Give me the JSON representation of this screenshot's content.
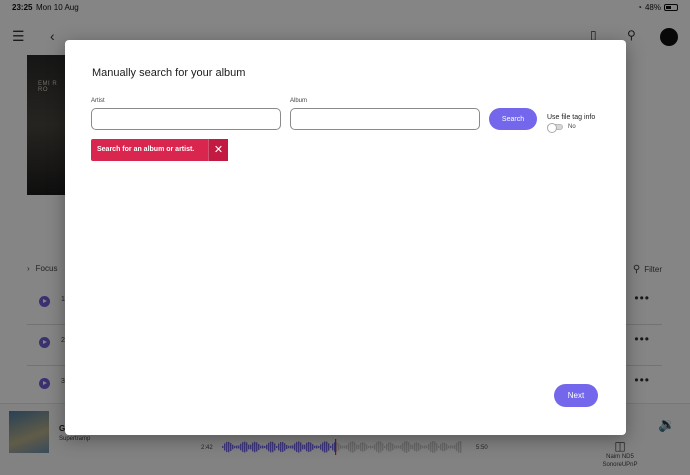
{
  "status_bar": {
    "time": "23:25",
    "date": "Mon 10 Aug",
    "battery": "48%"
  },
  "background": {
    "focus_label": "Focus",
    "filter_label": "Filter",
    "artwork_text": "EMI R RO",
    "tracks": [
      {
        "number": "1"
      },
      {
        "number": "2"
      },
      {
        "number": "3"
      }
    ]
  },
  "player": {
    "title": "G",
    "artist": "Supertramp",
    "elapsed": "2:42",
    "duration": "5:50",
    "device_name": "Naim ND5",
    "device_source": "SonoreUPnP"
  },
  "modal": {
    "title": "Manually search for your album",
    "artist_label": "Artist",
    "artist_value": "",
    "album_label": "Album",
    "album_value": "",
    "search_label": "Search",
    "file_tag_label": "Use file tag info",
    "file_tag_state": "No",
    "error_message": "Search for an album or artist.",
    "next_label": "Next"
  },
  "colors": {
    "accent": "#7467ec",
    "error": "#d8264f",
    "track_play": "#6d5fd6"
  },
  "icons": [
    "wifi-icon",
    "battery-icon",
    "menu-icon",
    "back-icon",
    "bookmark-icon",
    "search-icon",
    "avatar",
    "chevron-right-icon",
    "filter-search-icon",
    "play-icon",
    "more-icon",
    "speaker-icon",
    "volume-icon",
    "close-icon"
  ]
}
